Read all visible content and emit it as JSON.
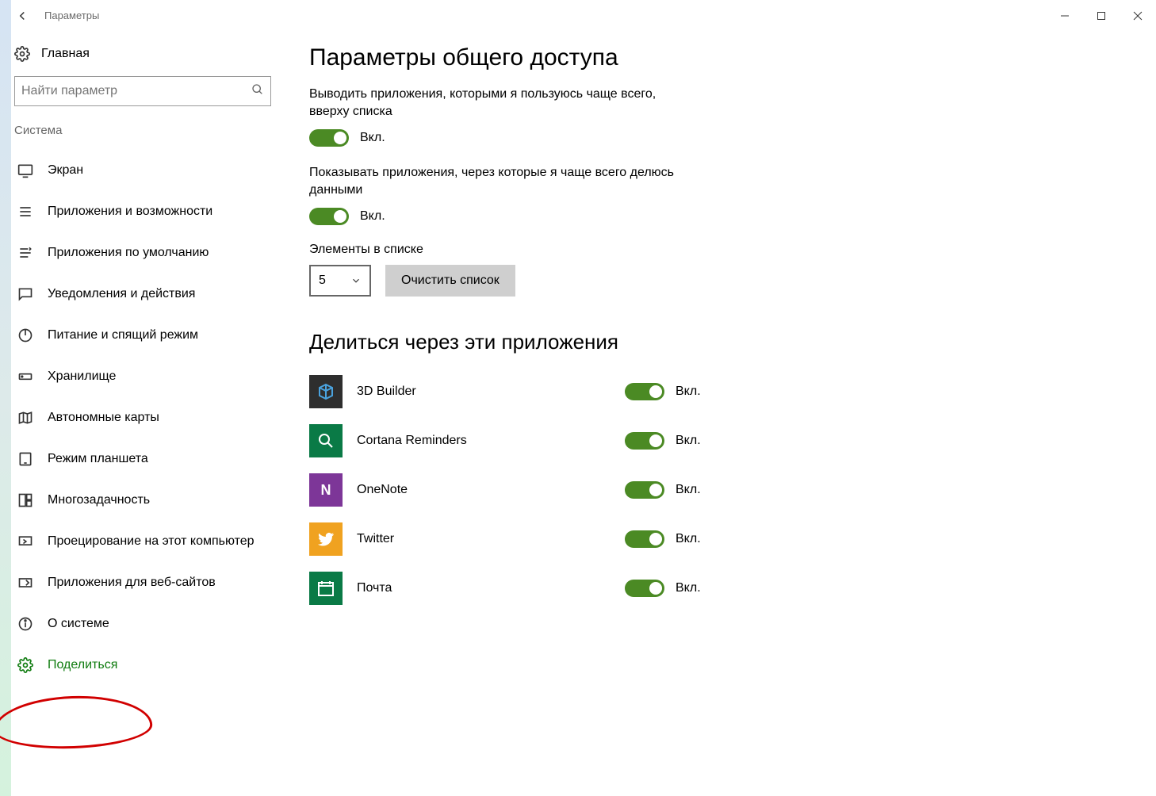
{
  "window": {
    "title": "Параметры"
  },
  "sidebar": {
    "home": "Главная",
    "search_placeholder": "Найти параметр",
    "section_label": "Система",
    "items": [
      {
        "label": "Экран"
      },
      {
        "label": "Приложения и возможности"
      },
      {
        "label": "Приложения по умолчанию"
      },
      {
        "label": "Уведомления и действия"
      },
      {
        "label": "Питание и спящий режим"
      },
      {
        "label": "Хранилище"
      },
      {
        "label": "Автономные карты"
      },
      {
        "label": "Режим планшета"
      },
      {
        "label": "Многозадачность"
      },
      {
        "label": "Проецирование на этот компьютер"
      },
      {
        "label": "Приложения для веб-сайтов"
      },
      {
        "label": "О системе"
      },
      {
        "label": "Поделиться"
      }
    ]
  },
  "main": {
    "heading": "Параметры общего доступа",
    "opt1_text": "Выводить приложения, которыми я пользуюсь чаще всего, вверху списка",
    "opt2_text": "Показывать приложения, через которые я чаще всего делюсь данными",
    "on_label": "Вкл.",
    "list_label": "Элементы в списке",
    "list_value": "5",
    "clear_label": "Очистить список",
    "apps_heading": "Делиться через эти приложения",
    "apps": [
      {
        "label": "3D Builder",
        "tile_bg": "#2e2e2e",
        "tile_txt": "",
        "state": "Вкл."
      },
      {
        "label": "Cortana Reminders",
        "tile_bg": "#0a7a46",
        "tile_txt": "",
        "state": "Вкл."
      },
      {
        "label": "OneNote",
        "tile_bg": "#7d3698",
        "tile_txt": "N",
        "state": "Вкл."
      },
      {
        "label": "Twitter",
        "tile_bg": "#f0a220",
        "tile_txt": "",
        "state": "Вкл."
      },
      {
        "label": "Почта",
        "tile_bg": "#0a7a46",
        "tile_txt": "",
        "state": "Вкл."
      }
    ]
  }
}
